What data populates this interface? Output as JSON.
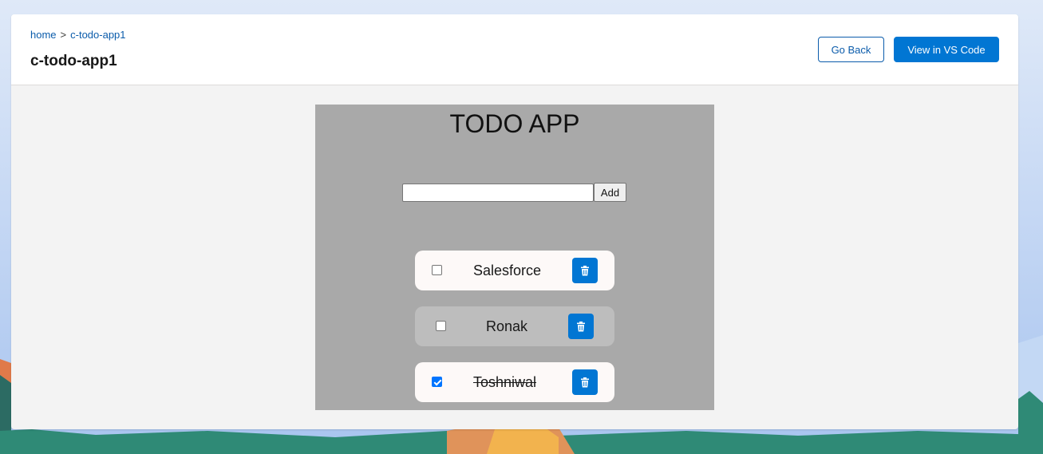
{
  "breadcrumb": {
    "home": "home",
    "separator": ">",
    "current": "c-todo-app1"
  },
  "header": {
    "title": "c-todo-app1",
    "go_back_label": "Go Back",
    "vscode_label": "View in VS Code"
  },
  "todo_app": {
    "title": "TODO APP",
    "input_value": "",
    "add_label": "Add",
    "items": [
      {
        "label": "Salesforce",
        "checked": false
      },
      {
        "label": "Ronak",
        "checked": false
      },
      {
        "label": "Toshniwal",
        "checked": true
      }
    ]
  },
  "colors": {
    "brand": "#0176d3",
    "todo_panel": "#a9a9a9",
    "item_bg": "#fdf9f8",
    "item_bg_alt": "#bdbdbd"
  },
  "icons": {
    "delete": "trash-icon"
  }
}
